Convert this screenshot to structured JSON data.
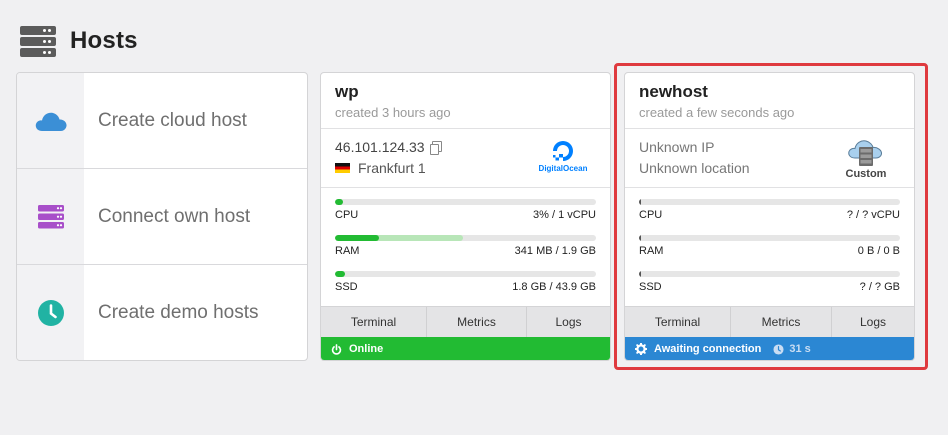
{
  "page": {
    "title": "Hosts",
    "icon": "server-stack-icon"
  },
  "actions": [
    {
      "label": "Create cloud host",
      "icon": "cloud-icon",
      "color": "#3b8fd6"
    },
    {
      "label": "Connect own host",
      "icon": "server-icon",
      "color": "#a84fc9"
    },
    {
      "label": "Create demo hosts",
      "icon": "clock-icon",
      "color": "#21b3a3"
    }
  ],
  "hosts": [
    {
      "name": "wp",
      "created": "created 3 hours ago",
      "ip": "46.101.124.33",
      "location": "Frankfurt 1",
      "provider": {
        "name": "DigitalOcean",
        "icon": "digitalocean-logo"
      },
      "metrics": [
        {
          "label": "CPU",
          "value": "3% / 1 vCPU",
          "fraction": 0.03
        },
        {
          "label": "RAM",
          "value": "341 MB / 1.9 GB",
          "fraction": 0.17,
          "secondary_fraction": 0.49
        },
        {
          "label": "SSD",
          "value": "1.8 GB / 43.9 GB",
          "fraction": 0.04
        }
      ],
      "tabs": [
        "Terminal",
        "Metrics",
        "Logs"
      ],
      "status": {
        "text": "Online",
        "color": "#22bb33",
        "icon": "power-icon"
      }
    },
    {
      "name": "newhost",
      "created": "created a few seconds ago",
      "ip": "Unknown IP",
      "location": "Unknown location",
      "provider": {
        "name": "Custom",
        "icon": "custom-cloud-server-icon"
      },
      "metrics": [
        {
          "label": "CPU",
          "value": "? / ? vCPU"
        },
        {
          "label": "RAM",
          "value": "0 B / 0 B"
        },
        {
          "label": "SSD",
          "value": "? / ? GB"
        }
      ],
      "tabs": [
        "Terminal",
        "Metrics",
        "Logs"
      ],
      "status": {
        "text": "Awaiting connection",
        "timer": "31 s",
        "color": "#2b87d3",
        "icon": "gear-icon"
      }
    }
  ],
  "highlight_color": "#df3a3f"
}
